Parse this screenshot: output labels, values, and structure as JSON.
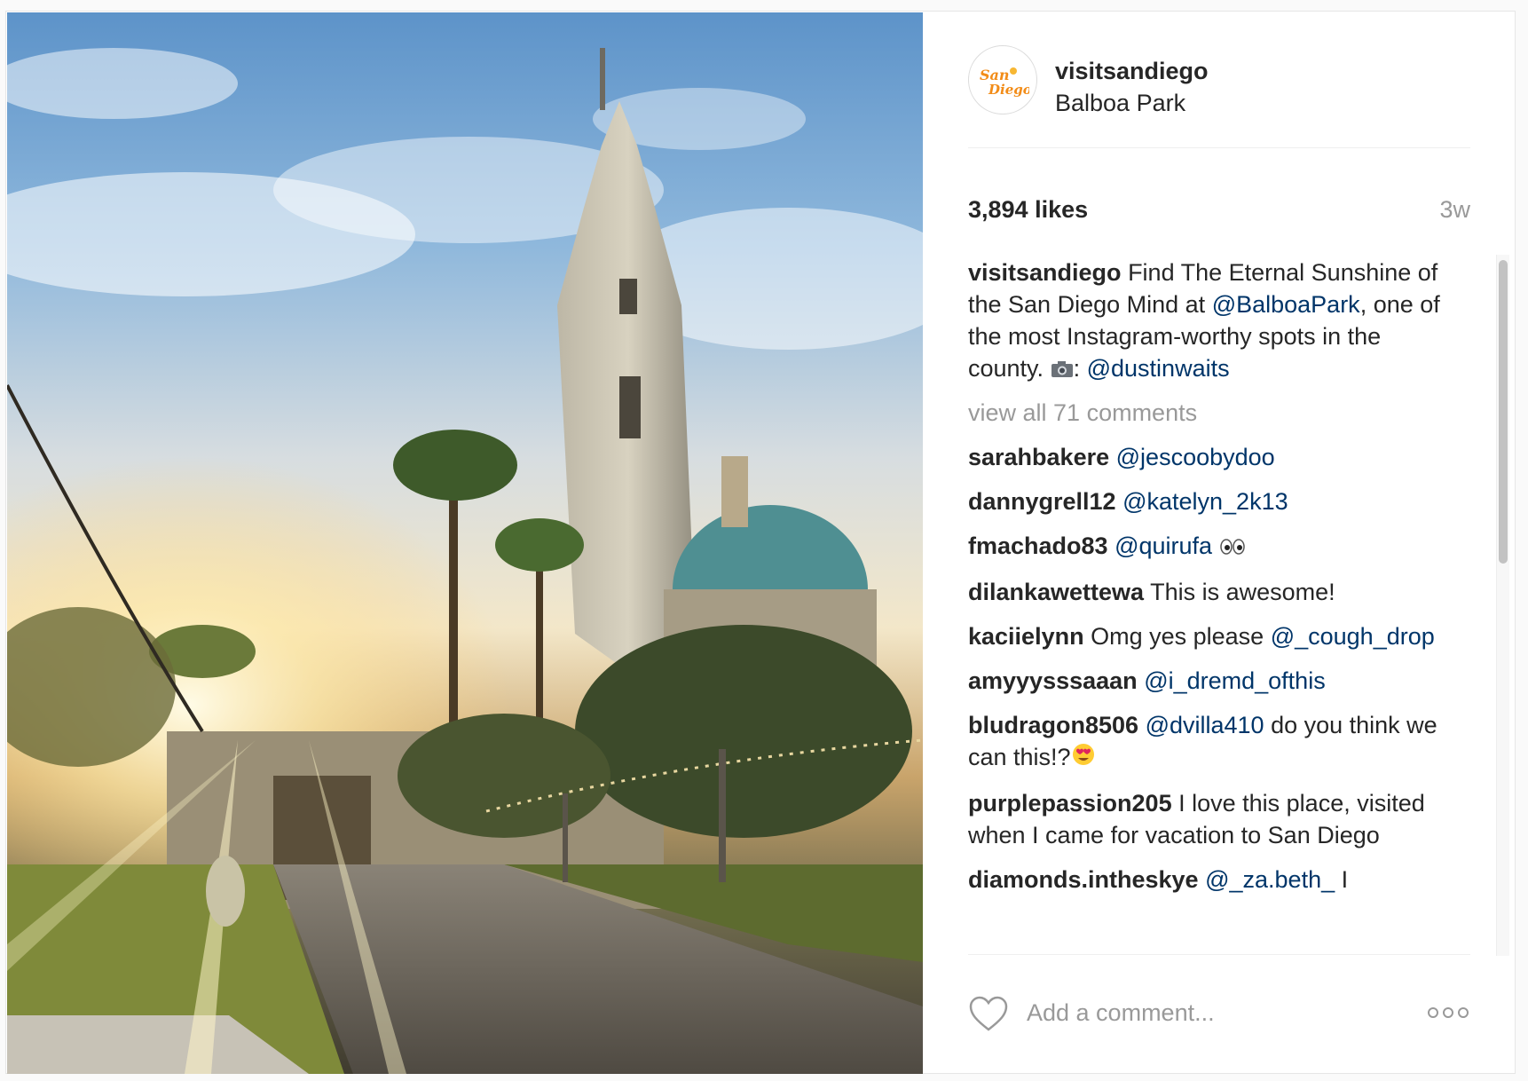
{
  "post": {
    "username": "visitsandiego",
    "location": "Balboa Park",
    "avatar_text": "San Diego",
    "likes": "3,894 likes",
    "time": "3w",
    "caption": {
      "user": "visitsandiego",
      "text_1": "Find The Eternal Sunshine of the San Diego Mind at",
      "mention_1": "@BalboaPark",
      "text_2": ", one of the most Instagram-worthy spots in the county.",
      "camera_icon": "camera-icon",
      "text_3": ":",
      "mention_2": "@dustinwaits"
    },
    "view_all": "view all 71 comments"
  },
  "comments": [
    {
      "user": "sarahbakere",
      "mention": "@jescoobydoo",
      "text": ""
    },
    {
      "user": "dannygrell12",
      "mention": "@katelyn_2k13",
      "text": ""
    },
    {
      "user": "fmachado83",
      "mention": "@quirufa",
      "text": "",
      "emoji": "eyes-emoji"
    },
    {
      "user": "dilankawettewa",
      "mention": "",
      "text": "This is awesome!"
    },
    {
      "user": "kaciielynn",
      "text": "Omg yes please",
      "mention": "@_cough_drop"
    },
    {
      "user": "amyyysssaaan",
      "mention": "@i_dremd_ofthis",
      "text": ""
    },
    {
      "user": "bludragon8506",
      "mention": "@dvilla410",
      "text": "do you think we can this!?",
      "emoji": "heart-eyes-emoji"
    },
    {
      "user": "purplepassion205",
      "mention": "",
      "text": "I love this place, visited when I came for vacation to San Diego"
    },
    {
      "user": "diamonds.intheskye",
      "mention": "@_za.beth_",
      "text": "I"
    }
  ],
  "footer": {
    "placeholder": "Add a comment...",
    "like_icon": "heart-outline-icon",
    "more_icon": "more-options-icon"
  },
  "colors": {
    "mention": "#003569",
    "muted": "#999999",
    "text": "#262626"
  }
}
